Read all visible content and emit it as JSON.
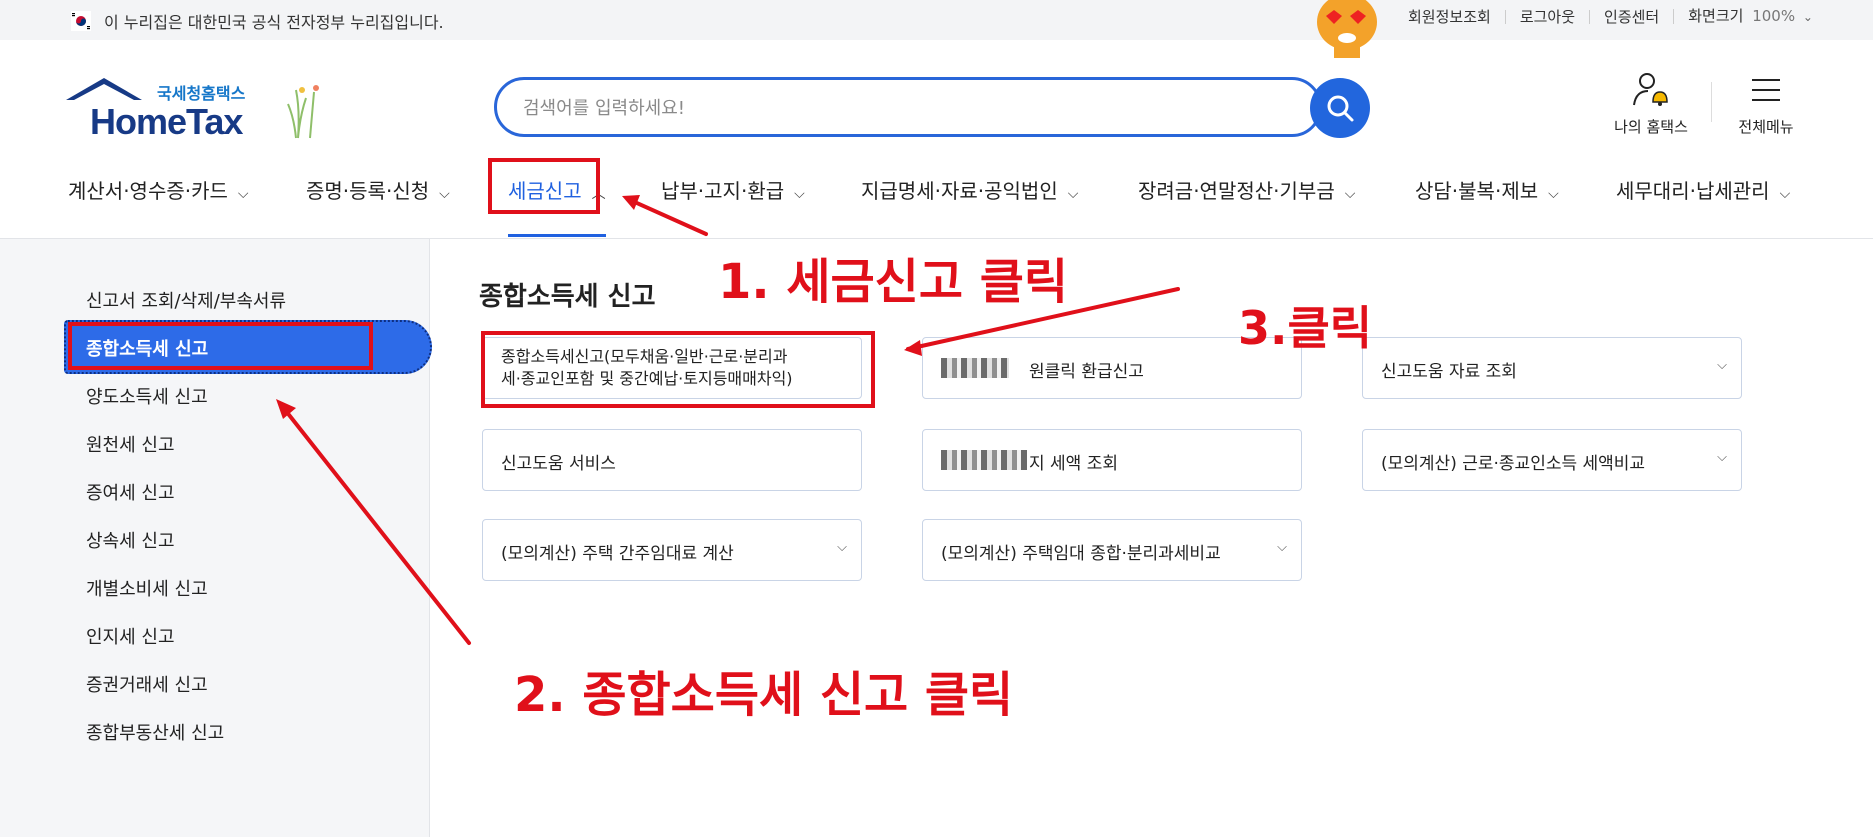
{
  "topbar": {
    "gov_text": "이 누리집은 대한민국 공식 전자정부 누리집입니다.",
    "links": [
      "회원정보조회",
      "로그아웃",
      "인증센터",
      "화면크기"
    ],
    "zoom": "100%"
  },
  "header": {
    "logo_kr": "국세청홈택스",
    "logo_en": "HomeTax",
    "search_placeholder": "검색어를 입력하세요!",
    "my_hometax": "나의 홈택스",
    "all_menu": "전체메뉴"
  },
  "gnb": {
    "items": [
      "계산서·영수증·카드",
      "증명·등록·신청",
      "세금신고",
      "납부·고지·환급",
      "지급명세·자료·공익법인",
      "장려금·연말정산·기부금",
      "상담·불복·제보",
      "세무대리·납세관리"
    ],
    "active_index": 2
  },
  "sidebar": {
    "items": [
      "신고서 조회/삭제/부속서류",
      "종합소득세 신고",
      "양도소득세 신고",
      "원천세 신고",
      "증여세 신고",
      "상속세 신고",
      "개별소비세 신고",
      "인지세 신고",
      "증권거래세 신고",
      "종합부동산세 신고"
    ],
    "active_index": 1
  },
  "main": {
    "title": "종합소득세 신고",
    "cards": {
      "c1_line1": "종합소득세신고(모두채움·일반·근로·분리과",
      "c1_line2": "세·종교인포함 및 중간예납·토지등매매차익)",
      "c2": "원클릭 환급신고",
      "c3": "신고도움 자료 조회",
      "c4": "신고도움 서비스",
      "c5": "지 세액 조회",
      "c6": "(모의계산) 근로·종교인소득 세액비교",
      "c7": "(모의계산) 주택 간주임대료 계산",
      "c8": "(모의계산) 주택임대 종합·분리과세비교"
    }
  },
  "annotations": {
    "step1": "1. 세금신고 클릭",
    "step2": "2. 종합소득세 신고 클릭",
    "step3": "3.클릭",
    "color": "#e0101a"
  },
  "colors": {
    "primary": "#2061e0",
    "sidebar_active": "#2d6be8",
    "logo": "#173a86"
  }
}
